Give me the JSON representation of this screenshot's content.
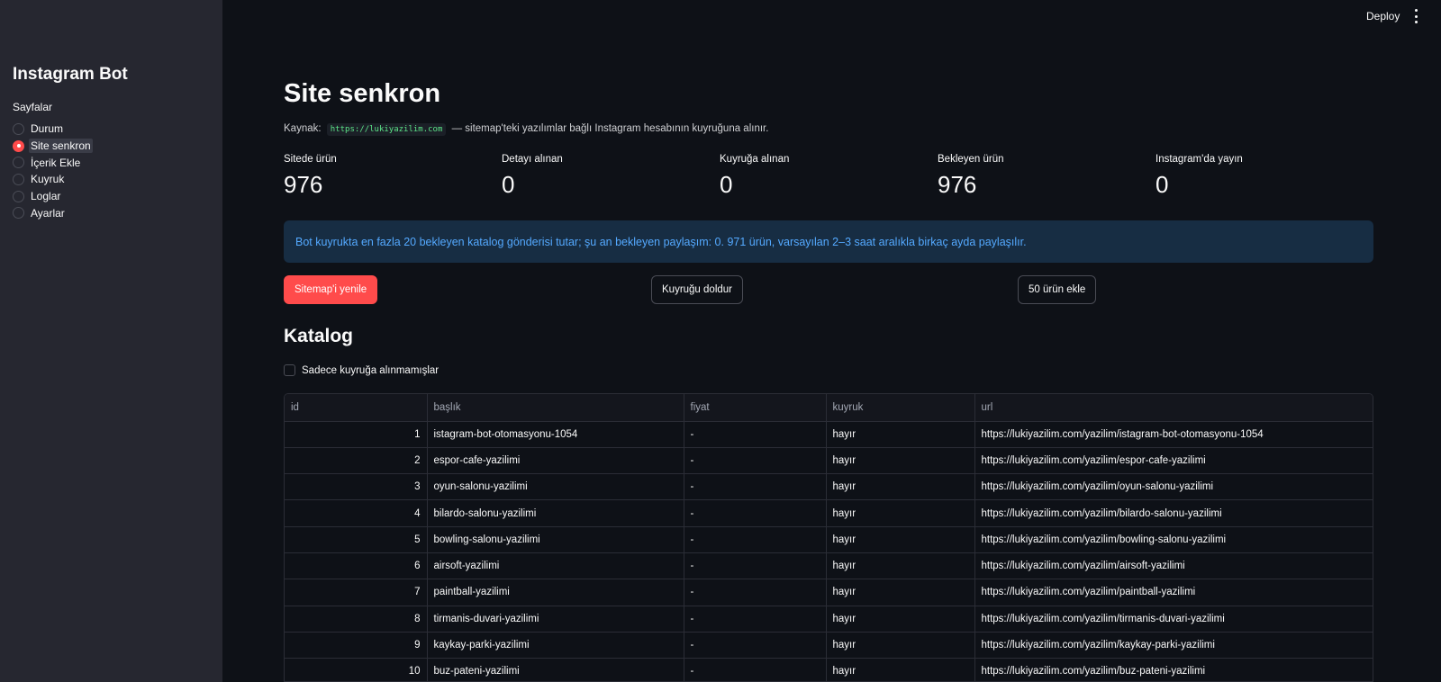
{
  "sidebar": {
    "title": "Instagram Bot",
    "nav_label": "Sayfalar",
    "items": [
      {
        "label": "Durum",
        "active": false
      },
      {
        "label": "Site senkron",
        "active": true
      },
      {
        "label": "İçerik Ekle",
        "active": false
      },
      {
        "label": "Kuyruk",
        "active": false
      },
      {
        "label": "Loglar",
        "active": false
      },
      {
        "label": "Ayarlar",
        "active": false
      }
    ]
  },
  "topbar": {
    "deploy_label": "Deploy",
    "menu_icon": "more-vertical-icon"
  },
  "page": {
    "title": "Site senkron",
    "source_prefix": "Kaynak:",
    "source_url": "https://lukiyazilim.com",
    "source_suffix": "— sitemap'teki yazılımlar bağlı Instagram hesabının kuyruğuna alınır."
  },
  "metrics": [
    {
      "label": "Sitede ürün",
      "value": "976"
    },
    {
      "label": "Detayı alınan",
      "value": "0"
    },
    {
      "label": "Kuyruğa alınan",
      "value": "0"
    },
    {
      "label": "Bekleyen ürün",
      "value": "976"
    },
    {
      "label": "Instagram'da yayın",
      "value": "0"
    }
  ],
  "info": {
    "text": "Bot kuyrukta en fazla 20 bekleyen katalog gönderisi tutar; şu an bekleyen paylaşım: 0. 971 ürün, varsayılan 2–3 saat aralıkla birkaç ayda paylaşılır."
  },
  "buttons": {
    "refresh_sitemap": "Sitemap'i yenile",
    "fill_queue": "Kuyruğu doldur",
    "add_50": "50 ürün ekle"
  },
  "catalog": {
    "title": "Katalog",
    "filter_label": "Sadece kuyruğa alınmamışlar",
    "columns": [
      "id",
      "başlık",
      "fiyat",
      "kuyruk",
      "url"
    ],
    "rows": [
      [
        "1",
        "istagram-bot-otomasyonu-1054",
        "-",
        "hayır",
        "https://lukiyazilim.com/yazilim/istagram-bot-otomasyonu-1054"
      ],
      [
        "2",
        "espor-cafe-yazilimi",
        "-",
        "hayır",
        "https://lukiyazilim.com/yazilim/espor-cafe-yazilimi"
      ],
      [
        "3",
        "oyun-salonu-yazilimi",
        "-",
        "hayır",
        "https://lukiyazilim.com/yazilim/oyun-salonu-yazilimi"
      ],
      [
        "4",
        "bilardo-salonu-yazilimi",
        "-",
        "hayır",
        "https://lukiyazilim.com/yazilim/bilardo-salonu-yazilimi"
      ],
      [
        "5",
        "bowling-salonu-yazilimi",
        "-",
        "hayır",
        "https://lukiyazilim.com/yazilim/bowling-salonu-yazilimi"
      ],
      [
        "6",
        "airsoft-yazilimi",
        "-",
        "hayır",
        "https://lukiyazilim.com/yazilim/airsoft-yazilimi"
      ],
      [
        "7",
        "paintball-yazilimi",
        "-",
        "hayır",
        "https://lukiyazilim.com/yazilim/paintball-yazilimi"
      ],
      [
        "8",
        "tirmanis-duvari-yazilimi",
        "-",
        "hayır",
        "https://lukiyazilim.com/yazilim/tirmanis-duvari-yazilimi"
      ],
      [
        "9",
        "kaykay-parki-yazilimi",
        "-",
        "hayır",
        "https://lukiyazilim.com/yazilim/kaykay-parki-yazilimi"
      ],
      [
        "10",
        "buz-pateni-yazilimi",
        "-",
        "hayır",
        "https://lukiyazilim.com/yazilim/buz-pateni-yazilimi"
      ]
    ]
  },
  "colors": {
    "background": "#0e1117",
    "sidebar": "#262730",
    "accent": "#ff4b4b",
    "info_bg": "#172d43",
    "info_text": "#54a9ff",
    "code_text": "#5ce488"
  }
}
